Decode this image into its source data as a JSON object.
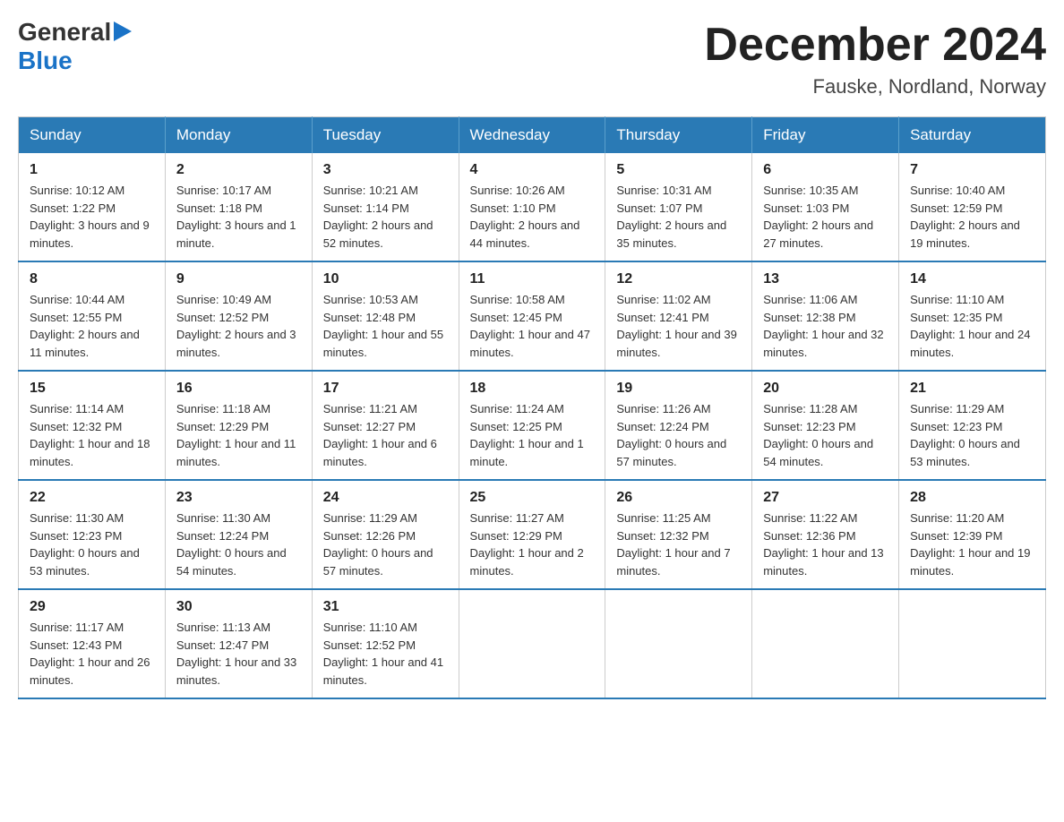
{
  "logo": {
    "text_general": "General",
    "arrow": "▶",
    "text_blue": "Blue"
  },
  "title": "December 2024",
  "subtitle": "Fauske, Nordland, Norway",
  "header_days": [
    "Sunday",
    "Monday",
    "Tuesday",
    "Wednesday",
    "Thursday",
    "Friday",
    "Saturday"
  ],
  "weeks": [
    [
      {
        "day": "1",
        "sunrise": "Sunrise: 10:12 AM",
        "sunset": "Sunset: 1:22 PM",
        "daylight": "Daylight: 3 hours and 9 minutes."
      },
      {
        "day": "2",
        "sunrise": "Sunrise: 10:17 AM",
        "sunset": "Sunset: 1:18 PM",
        "daylight": "Daylight: 3 hours and 1 minute."
      },
      {
        "day": "3",
        "sunrise": "Sunrise: 10:21 AM",
        "sunset": "Sunset: 1:14 PM",
        "daylight": "Daylight: 2 hours and 52 minutes."
      },
      {
        "day": "4",
        "sunrise": "Sunrise: 10:26 AM",
        "sunset": "Sunset: 1:10 PM",
        "daylight": "Daylight: 2 hours and 44 minutes."
      },
      {
        "day": "5",
        "sunrise": "Sunrise: 10:31 AM",
        "sunset": "Sunset: 1:07 PM",
        "daylight": "Daylight: 2 hours and 35 minutes."
      },
      {
        "day": "6",
        "sunrise": "Sunrise: 10:35 AM",
        "sunset": "Sunset: 1:03 PM",
        "daylight": "Daylight: 2 hours and 27 minutes."
      },
      {
        "day": "7",
        "sunrise": "Sunrise: 10:40 AM",
        "sunset": "Sunset: 12:59 PM",
        "daylight": "Daylight: 2 hours and 19 minutes."
      }
    ],
    [
      {
        "day": "8",
        "sunrise": "Sunrise: 10:44 AM",
        "sunset": "Sunset: 12:55 PM",
        "daylight": "Daylight: 2 hours and 11 minutes."
      },
      {
        "day": "9",
        "sunrise": "Sunrise: 10:49 AM",
        "sunset": "Sunset: 12:52 PM",
        "daylight": "Daylight: 2 hours and 3 minutes."
      },
      {
        "day": "10",
        "sunrise": "Sunrise: 10:53 AM",
        "sunset": "Sunset: 12:48 PM",
        "daylight": "Daylight: 1 hour and 55 minutes."
      },
      {
        "day": "11",
        "sunrise": "Sunrise: 10:58 AM",
        "sunset": "Sunset: 12:45 PM",
        "daylight": "Daylight: 1 hour and 47 minutes."
      },
      {
        "day": "12",
        "sunrise": "Sunrise: 11:02 AM",
        "sunset": "Sunset: 12:41 PM",
        "daylight": "Daylight: 1 hour and 39 minutes."
      },
      {
        "day": "13",
        "sunrise": "Sunrise: 11:06 AM",
        "sunset": "Sunset: 12:38 PM",
        "daylight": "Daylight: 1 hour and 32 minutes."
      },
      {
        "day": "14",
        "sunrise": "Sunrise: 11:10 AM",
        "sunset": "Sunset: 12:35 PM",
        "daylight": "Daylight: 1 hour and 24 minutes."
      }
    ],
    [
      {
        "day": "15",
        "sunrise": "Sunrise: 11:14 AM",
        "sunset": "Sunset: 12:32 PM",
        "daylight": "Daylight: 1 hour and 18 minutes."
      },
      {
        "day": "16",
        "sunrise": "Sunrise: 11:18 AM",
        "sunset": "Sunset: 12:29 PM",
        "daylight": "Daylight: 1 hour and 11 minutes."
      },
      {
        "day": "17",
        "sunrise": "Sunrise: 11:21 AM",
        "sunset": "Sunset: 12:27 PM",
        "daylight": "Daylight: 1 hour and 6 minutes."
      },
      {
        "day": "18",
        "sunrise": "Sunrise: 11:24 AM",
        "sunset": "Sunset: 12:25 PM",
        "daylight": "Daylight: 1 hour and 1 minute."
      },
      {
        "day": "19",
        "sunrise": "Sunrise: 11:26 AM",
        "sunset": "Sunset: 12:24 PM",
        "daylight": "Daylight: 0 hours and 57 minutes."
      },
      {
        "day": "20",
        "sunrise": "Sunrise: 11:28 AM",
        "sunset": "Sunset: 12:23 PM",
        "daylight": "Daylight: 0 hours and 54 minutes."
      },
      {
        "day": "21",
        "sunrise": "Sunrise: 11:29 AM",
        "sunset": "Sunset: 12:23 PM",
        "daylight": "Daylight: 0 hours and 53 minutes."
      }
    ],
    [
      {
        "day": "22",
        "sunrise": "Sunrise: 11:30 AM",
        "sunset": "Sunset: 12:23 PM",
        "daylight": "Daylight: 0 hours and 53 minutes."
      },
      {
        "day": "23",
        "sunrise": "Sunrise: 11:30 AM",
        "sunset": "Sunset: 12:24 PM",
        "daylight": "Daylight: 0 hours and 54 minutes."
      },
      {
        "day": "24",
        "sunrise": "Sunrise: 11:29 AM",
        "sunset": "Sunset: 12:26 PM",
        "daylight": "Daylight: 0 hours and 57 minutes."
      },
      {
        "day": "25",
        "sunrise": "Sunrise: 11:27 AM",
        "sunset": "Sunset: 12:29 PM",
        "daylight": "Daylight: 1 hour and 2 minutes."
      },
      {
        "day": "26",
        "sunrise": "Sunrise: 11:25 AM",
        "sunset": "Sunset: 12:32 PM",
        "daylight": "Daylight: 1 hour and 7 minutes."
      },
      {
        "day": "27",
        "sunrise": "Sunrise: 11:22 AM",
        "sunset": "Sunset: 12:36 PM",
        "daylight": "Daylight: 1 hour and 13 minutes."
      },
      {
        "day": "28",
        "sunrise": "Sunrise: 11:20 AM",
        "sunset": "Sunset: 12:39 PM",
        "daylight": "Daylight: 1 hour and 19 minutes."
      }
    ],
    [
      {
        "day": "29",
        "sunrise": "Sunrise: 11:17 AM",
        "sunset": "Sunset: 12:43 PM",
        "daylight": "Daylight: 1 hour and 26 minutes."
      },
      {
        "day": "30",
        "sunrise": "Sunrise: 11:13 AM",
        "sunset": "Sunset: 12:47 PM",
        "daylight": "Daylight: 1 hour and 33 minutes."
      },
      {
        "day": "31",
        "sunrise": "Sunrise: 11:10 AM",
        "sunset": "Sunset: 12:52 PM",
        "daylight": "Daylight: 1 hour and 41 minutes."
      },
      null,
      null,
      null,
      null
    ]
  ]
}
